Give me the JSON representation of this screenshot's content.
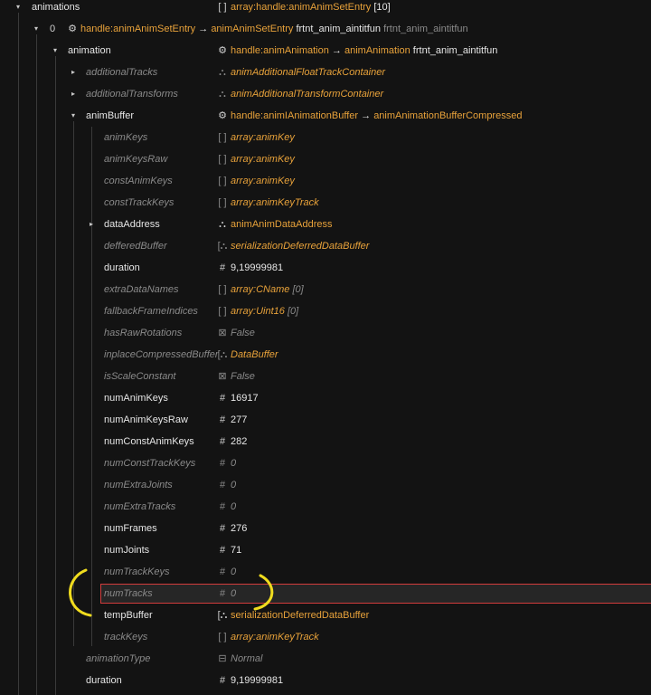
{
  "rows": [
    {
      "label": "animations",
      "icon": "[ ]",
      "icon_name": "array-icon",
      "parts": [
        {
          "t": "array:handle:animAnimSetEntry",
          "c": "or"
        },
        {
          "t": " [10]",
          "c": "wh"
        }
      ]
    },
    {
      "label": "0",
      "icon": "⚙",
      "icon_name": "handle-icon",
      "parts": [
        {
          "t": "handle:animAnimSetEntry",
          "c": "or"
        },
        {
          "t": " → ",
          "c": "wh"
        },
        {
          "t": "animAnimSetEntry",
          "c": "or"
        },
        {
          "t": " frtnt_anim_aintitfun",
          "c": "wh"
        },
        {
          "t": " frtnt_anim_aintitfun",
          "c": "gr"
        }
      ]
    },
    {
      "label": "animation",
      "icon": "⚙",
      "icon_name": "handle-icon",
      "parts": [
        {
          "t": "handle:animAnimation",
          "c": "or"
        },
        {
          "t": " → ",
          "c": "wh"
        },
        {
          "t": "animAnimation",
          "c": "or"
        },
        {
          "t": " frtnt_anim_aintitfun",
          "c": "wh"
        }
      ]
    },
    {
      "label": "additionalTracks",
      "icon": "⛬",
      "icon_name": "struct-icon",
      "parts": [
        {
          "t": "animAdditionalFloatTrackContainer",
          "c": "orit"
        }
      ]
    },
    {
      "label": "additionalTransforms",
      "icon": "⛬",
      "icon_name": "struct-icon",
      "parts": [
        {
          "t": "animAdditionalTransformContainer",
          "c": "orit"
        }
      ]
    },
    {
      "label": "animBuffer",
      "icon": "⚙",
      "icon_name": "handle-icon",
      "parts": [
        {
          "t": "handle:animIAnimationBuffer",
          "c": "or"
        },
        {
          "t": " → ",
          "c": "wh"
        },
        {
          "t": "animAnimationBufferCompressed",
          "c": "or"
        }
      ]
    },
    {
      "label": "animKeys",
      "icon": "[ ]",
      "icon_name": "array-icon",
      "parts": [
        {
          "t": "array:animKey",
          "c": "orit"
        }
      ]
    },
    {
      "label": "animKeysRaw",
      "icon": "[ ]",
      "icon_name": "array-icon",
      "parts": [
        {
          "t": "array:animKey",
          "c": "orit"
        }
      ]
    },
    {
      "label": "constAnimKeys",
      "icon": "[ ]",
      "icon_name": "array-icon",
      "parts": [
        {
          "t": "array:animKey",
          "c": "orit"
        }
      ]
    },
    {
      "label": "constTrackKeys",
      "icon": "[ ]",
      "icon_name": "array-icon",
      "parts": [
        {
          "t": "array:animKeyTrack",
          "c": "orit"
        }
      ]
    },
    {
      "label": "dataAddress",
      "icon": "⛬",
      "icon_name": "struct-icon",
      "parts": [
        {
          "t": "animAnimDataAddress",
          "c": "or"
        }
      ]
    },
    {
      "label": "defferedBuffer",
      "icon": "[⛬",
      "icon_name": "buffer-icon",
      "parts": [
        {
          "t": "serializationDeferredDataBuffer",
          "c": "orit"
        }
      ]
    },
    {
      "label": "duration",
      "icon": "#",
      "icon_name": "number-icon",
      "parts": [
        {
          "t": "9,19999981",
          "c": "wh"
        }
      ]
    },
    {
      "label": "extraDataNames",
      "icon": "[ ]",
      "icon_name": "array-icon",
      "parts": [
        {
          "t": "array:CName",
          "c": "orit"
        },
        {
          "t": " [0]",
          "c": "grit"
        }
      ]
    },
    {
      "label": "fallbackFrameIndices",
      "icon": "[ ]",
      "icon_name": "array-icon",
      "parts": [
        {
          "t": "array:Uint16",
          "c": "orit"
        },
        {
          "t": " [0]",
          "c": "grit"
        }
      ]
    },
    {
      "label": "hasRawRotations",
      "icon": "⊠",
      "icon_name": "bool-icon",
      "parts": [
        {
          "t": "False",
          "c": "grit"
        }
      ]
    },
    {
      "label": "inplaceCompressedBuffer",
      "icon": "[⛬",
      "icon_name": "buffer-icon",
      "parts": [
        {
          "t": "DataBuffer",
          "c": "orit"
        }
      ]
    },
    {
      "label": "isScaleConstant",
      "icon": "⊠",
      "icon_name": "bool-icon",
      "parts": [
        {
          "t": "False",
          "c": "grit"
        }
      ]
    },
    {
      "label": "numAnimKeys",
      "icon": "#",
      "icon_name": "number-icon",
      "parts": [
        {
          "t": "16917",
          "c": "wh"
        }
      ]
    },
    {
      "label": "numAnimKeysRaw",
      "icon": "#",
      "icon_name": "number-icon",
      "parts": [
        {
          "t": "277",
          "c": "wh"
        }
      ]
    },
    {
      "label": "numConstAnimKeys",
      "icon": "#",
      "icon_name": "number-icon",
      "parts": [
        {
          "t": "282",
          "c": "wh"
        }
      ]
    },
    {
      "label": "numConstTrackKeys",
      "icon": "#",
      "icon_name": "number-icon",
      "parts": [
        {
          "t": "0",
          "c": "grit"
        }
      ]
    },
    {
      "label": "numExtraJoints",
      "icon": "#",
      "icon_name": "number-icon",
      "parts": [
        {
          "t": "0",
          "c": "grit"
        }
      ]
    },
    {
      "label": "numExtraTracks",
      "icon": "#",
      "icon_name": "number-icon",
      "parts": [
        {
          "t": "0",
          "c": "grit"
        }
      ]
    },
    {
      "label": "numFrames",
      "icon": "#",
      "icon_name": "number-icon",
      "parts": [
        {
          "t": "276",
          "c": "wh"
        }
      ]
    },
    {
      "label": "numJoints",
      "icon": "#",
      "icon_name": "number-icon",
      "parts": [
        {
          "t": "71",
          "c": "wh"
        }
      ]
    },
    {
      "label": "numTrackKeys",
      "icon": "#",
      "icon_name": "number-icon",
      "parts": [
        {
          "t": "0",
          "c": "grit"
        }
      ]
    },
    {
      "label": "numTracks",
      "icon": "#",
      "icon_name": "number-icon",
      "parts": [
        {
          "t": "0",
          "c": "grit"
        }
      ]
    },
    {
      "label": "tempBuffer",
      "icon": "[⛬",
      "icon_name": "buffer-icon",
      "parts": [
        {
          "t": "serializationDeferredDataBuffer",
          "c": "or"
        }
      ]
    },
    {
      "label": "trackKeys",
      "icon": "[ ]",
      "icon_name": "array-icon",
      "parts": [
        {
          "t": "array:animKeyTrack",
          "c": "orit"
        }
      ]
    },
    {
      "label": "animationType",
      "icon": "⊟",
      "icon_name": "enum-icon",
      "parts": [
        {
          "t": "Normal",
          "c": "grit"
        }
      ]
    },
    {
      "label": "duration",
      "icon": "#",
      "icon_name": "number-icon",
      "parts": [
        {
          "t": "9,19999981",
          "c": "wh"
        }
      ]
    }
  ],
  "colors": {
    "accent": "#e8a23a",
    "selection_border": "#d23c3c",
    "annotation": "#f0dc1e",
    "background": "#131313"
  }
}
